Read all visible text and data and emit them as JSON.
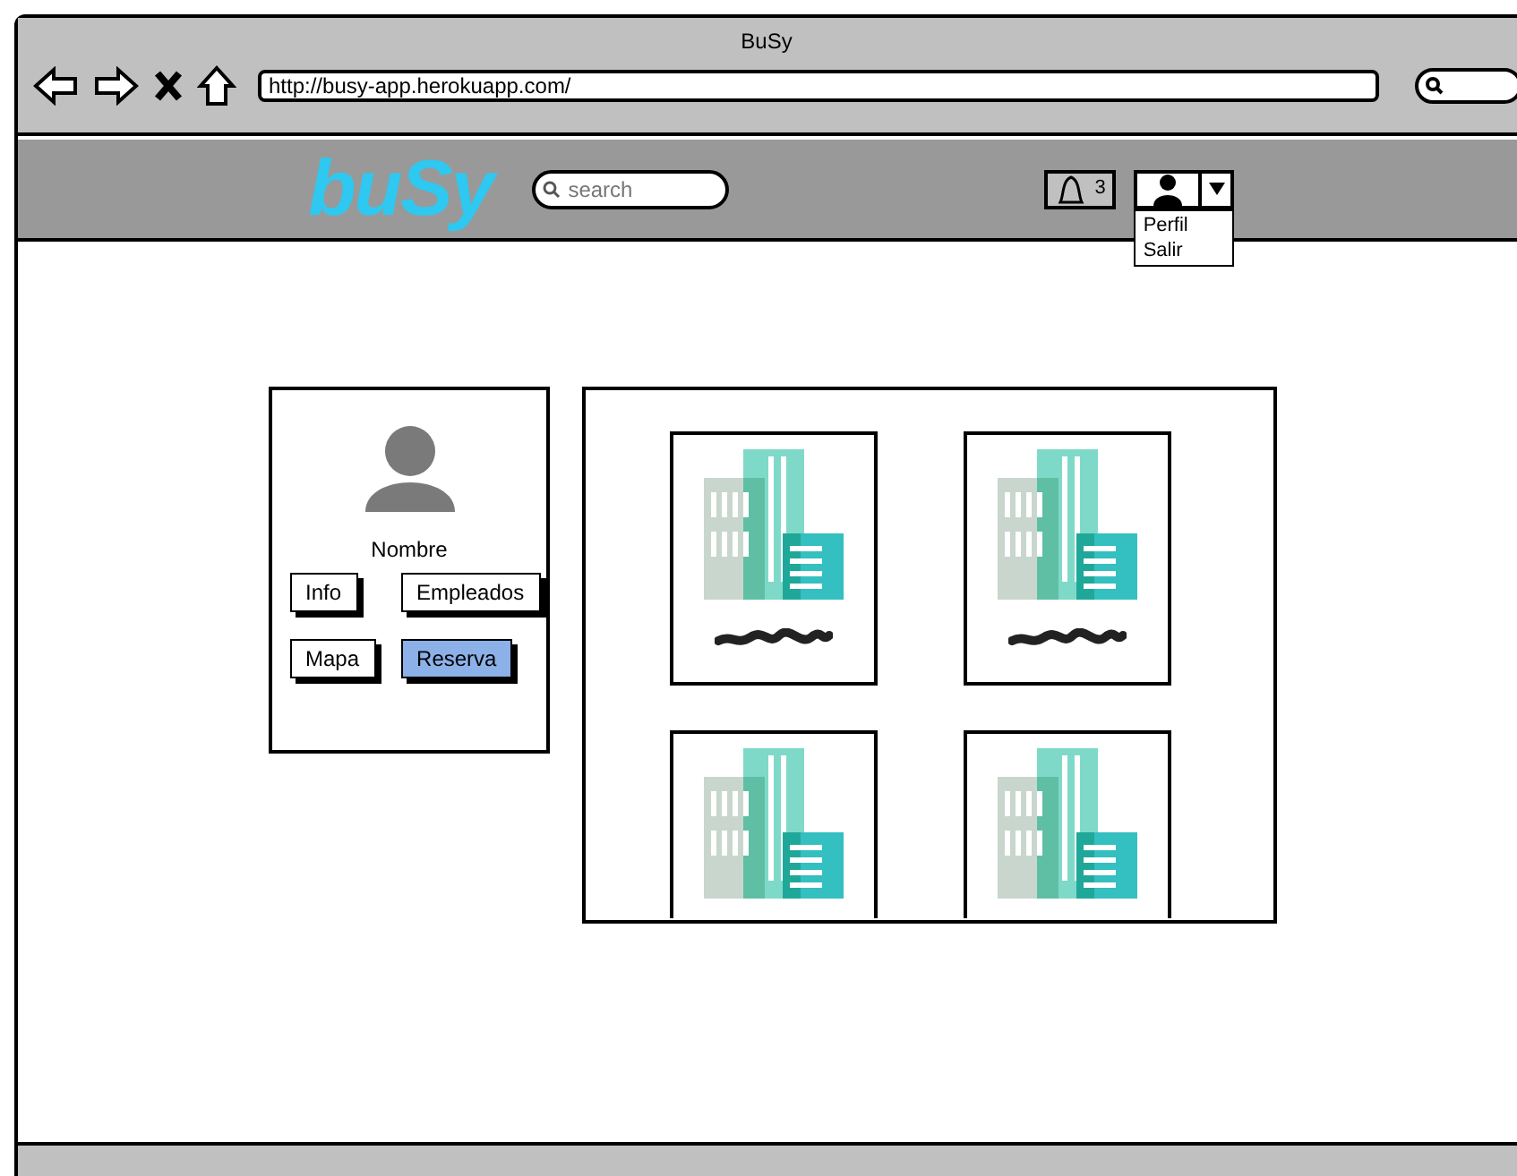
{
  "window": {
    "title": "BuSy"
  },
  "browser": {
    "url": "http://busy-app.herokuapp.com/"
  },
  "header": {
    "logo": "buSy",
    "search": {
      "placeholder": "search"
    },
    "notifications": {
      "count": "3"
    },
    "user_menu": {
      "expanded": true,
      "items": [
        "Perfil",
        "Salir"
      ]
    }
  },
  "profile": {
    "name": "Nombre",
    "buttons": [
      {
        "label": "Info",
        "selected": false
      },
      {
        "label": "Empleados",
        "selected": false
      },
      {
        "label": "Mapa",
        "selected": false
      },
      {
        "label": "Reserva",
        "selected": true
      }
    ]
  },
  "companies": [
    {
      "kind": "card"
    },
    {
      "kind": "card"
    },
    {
      "kind": "card"
    },
    {
      "kind": "card"
    }
  ]
}
